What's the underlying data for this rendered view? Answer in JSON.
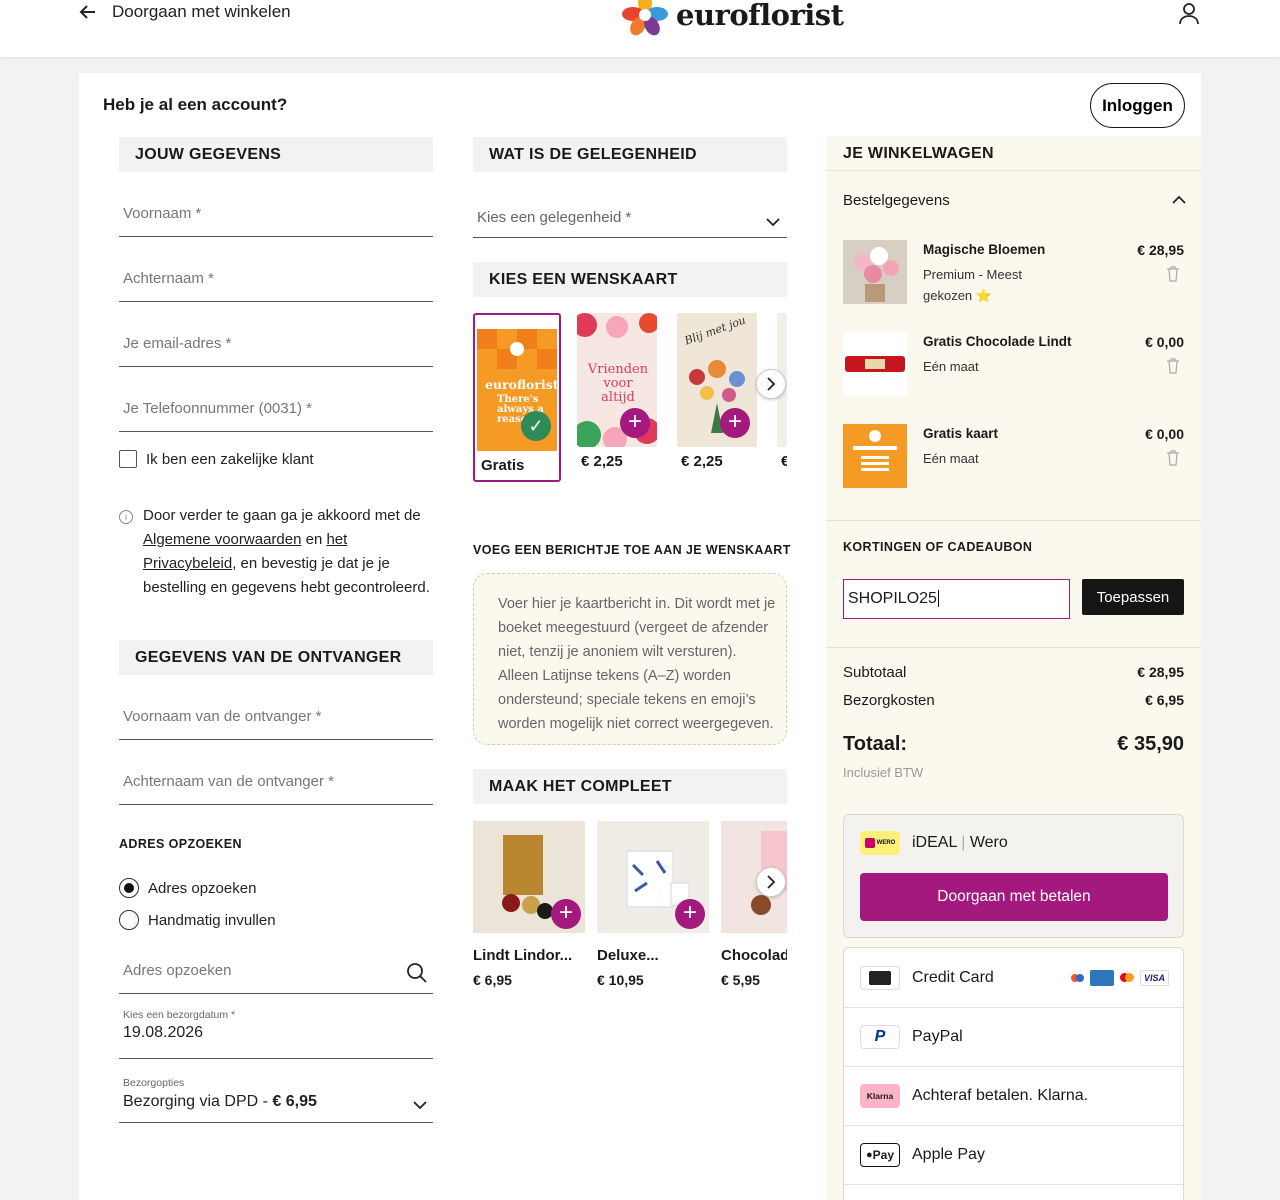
{
  "header": {
    "back_label": "Doorgaan met winkelen",
    "logo_text": "euroflorist"
  },
  "account": {
    "question": "Heb je al een account?",
    "login_label": "Inloggen"
  },
  "details": {
    "heading": "JOUW GEGEVENS",
    "first_name": "Voornaam *",
    "last_name": "Achternaam *",
    "email": "Je email-adres *",
    "phone": "Je Telefoonnummer (0031) *",
    "business_label": "Ik ben een zakelijke klant",
    "terms_pre": "Door verder te gaan ga je akkoord met de",
    "terms_link": "Algemene voorwaarden",
    "terms_and": "en",
    "privacy_link_1": "het",
    "privacy_link_2": "Privacybeleid",
    "terms_post": ", en bevestig je dat je je bestelling en gegevens hebt gecontroleerd."
  },
  "recipient": {
    "heading": "GEGEVENS VAN DE ONTVANGER",
    "first_name": "Voornaam van de ontvanger *",
    "last_name": "Achternaam van de ontvanger *"
  },
  "address": {
    "heading": "ADRES OPZOEKEN",
    "option_lookup": "Adres opzoeken",
    "option_manual": "Handmatig invullen",
    "search_placeholder": "Adres opzoeken",
    "date_label": "Kies een bezorgdatum *",
    "date_value": "19.08.2026",
    "delivery_label": "Bezorgopties",
    "delivery_value": "Bezorging via DPD -",
    "delivery_price": "€ 6,95"
  },
  "occasion": {
    "heading": "WAT IS DE GELEGENHEID",
    "placeholder": "Kies een gelegenheid *"
  },
  "cards": {
    "heading": "KIES EEN WENSKAART",
    "items": [
      {
        "price": "Gratis",
        "text": "euroflorist",
        "sub": "There's always a reason"
      },
      {
        "price": "€ 2,25",
        "text": "Vrienden voor altijd"
      },
      {
        "price": "€ 2,25",
        "text": "Blij met jou"
      },
      {
        "price": "€"
      }
    ]
  },
  "message": {
    "heading": "VOEG EEN BERICHTJE TOE AAN JE WENSKAART",
    "placeholder": "Voer hier je kaartbericht in. Dit wordt met je boeket meegestuurd (vergeet de afzender niet, tenzij je anoniem wilt versturen). Alleen Latijnse tekens (A–Z) worden ondersteund; speciale tekens en emoji’s worden mogelijk niet correct weergegeven."
  },
  "extras": {
    "heading": "MAAK HET COMPLEET",
    "items": [
      {
        "name": "Lindt Lindor...",
        "price": "€ 6,95"
      },
      {
        "name": "Deluxe...",
        "price": "€ 10,95"
      },
      {
        "name": "Chocolade",
        "price": "€ 5,95"
      }
    ]
  },
  "cart": {
    "heading": "JE WINKELWAGEN",
    "order_details": "Bestelgegevens",
    "items": [
      {
        "name": "Magische Bloemen",
        "sub": "Premium - Meest gekozen ⭐",
        "price": "€ 28,95"
      },
      {
        "name": "Gratis Chocolade Lindt",
        "sub": "Eén maat",
        "price": "€ 0,00"
      },
      {
        "name": "Gratis kaart",
        "sub": "Eén maat",
        "price": "€ 0,00"
      }
    ],
    "discount_heading": "KORTINGEN OF CADEAUBON",
    "discount_value": "SHOPILO25",
    "apply_label": "Toepassen",
    "subtotal_label": "Subtotaal",
    "subtotal_value": "€ 28,95",
    "shipping_label": "Bezorgkosten",
    "shipping_value": "€ 6,95",
    "total_label": "Totaal:",
    "total_value": "€ 35,90",
    "vat_note": "Inclusief BTW"
  },
  "payment": {
    "ideal_label": "iDEAL",
    "wero_label": "Wero",
    "ideal_badge": "WERO",
    "pay_button": "Doorgaan met betalen",
    "methods": [
      {
        "label": "Credit Card",
        "icon": "credit-card-icon"
      },
      {
        "label": "PayPal",
        "icon": "paypal-icon"
      },
      {
        "label": "Achteraf betalen. Klarna.",
        "icon": "klarna-icon",
        "badge": "Klarna"
      },
      {
        "label": "Apple Pay",
        "icon": "apple-pay-icon",
        "badge": "Pay"
      }
    ],
    "card_badges": [
      "VISA"
    ]
  },
  "colors": {
    "accent": "#a3197e",
    "cart_bg": "#fbf8ee",
    "section_bg": "#f2f2f2"
  }
}
